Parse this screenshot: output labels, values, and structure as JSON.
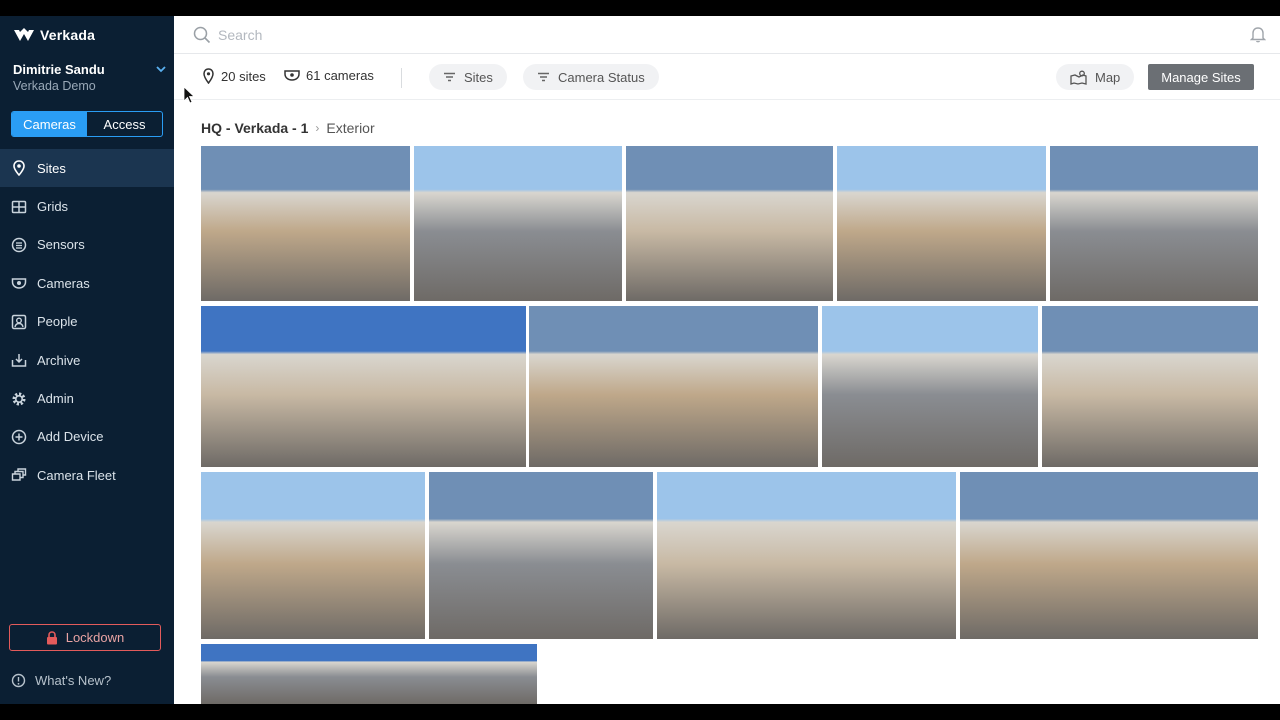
{
  "brand": {
    "name": "Verkada"
  },
  "user": {
    "name": "Dimitrie Sandu",
    "org": "Verkada Demo"
  },
  "mode_toggle": {
    "cameras": "Cameras",
    "access": "Access"
  },
  "nav": {
    "items": [
      {
        "label": "Sites",
        "icon": "pin-icon",
        "active": true
      },
      {
        "label": "Grids",
        "icon": "grid-icon"
      },
      {
        "label": "Sensors",
        "icon": "sensor-icon"
      },
      {
        "label": "Cameras",
        "icon": "camera-icon"
      },
      {
        "label": "People",
        "icon": "person-icon"
      },
      {
        "label": "Archive",
        "icon": "archive-icon"
      },
      {
        "label": "Admin",
        "icon": "gear-icon"
      },
      {
        "label": "Add Device",
        "icon": "plus-circle-icon"
      },
      {
        "label": "Camera Fleet",
        "icon": "fleet-icon"
      }
    ]
  },
  "lockdown": {
    "label": "Lockdown"
  },
  "whats_new": {
    "label": "What's New?"
  },
  "search": {
    "placeholder": "Search"
  },
  "toolbar": {
    "sites_count": "20 sites",
    "cameras_count": "61 cameras",
    "filter_sites": "Sites",
    "filter_status": "Camera Status",
    "map": "Map",
    "manage_sites": "Manage Sites"
  },
  "breadcrumb": {
    "site": "HQ - Verkada - 1",
    "current": "Exterior"
  },
  "camera_feeds": {
    "count": 15,
    "colors": [
      "#6f8fb5",
      "#3f74c2",
      "#9cc4ea",
      "#bfa88a",
      "#8a8d92",
      "#c8b9a4"
    ]
  }
}
